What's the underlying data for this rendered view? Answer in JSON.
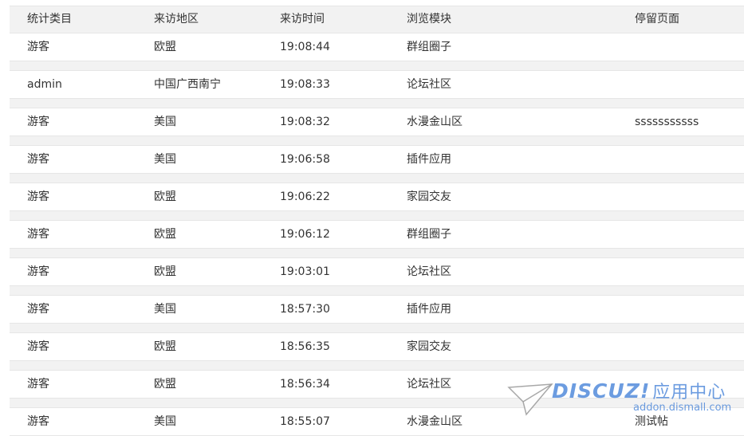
{
  "columns": [
    "统计类目",
    "来访地区",
    "来访时间",
    "浏览模块",
    "停留页面"
  ],
  "rows": [
    {
      "category": "游客",
      "region": "欧盟",
      "time": "19:08:44",
      "module": "群组圈子",
      "page": ""
    },
    {
      "category": "admin",
      "region": "中国广西南宁",
      "time": "19:08:33",
      "module": "论坛社区",
      "page": ""
    },
    {
      "category": "游客",
      "region": "美国",
      "time": "19:08:32",
      "module": "水漫金山区",
      "page": "sssssssssss"
    },
    {
      "category": "游客",
      "region": "美国",
      "time": "19:06:58",
      "module": "插件应用",
      "page": ""
    },
    {
      "category": "游客",
      "region": "欧盟",
      "time": "19:06:22",
      "module": "家园交友",
      "page": ""
    },
    {
      "category": "游客",
      "region": "欧盟",
      "time": "19:06:12",
      "module": "群组圈子",
      "page": ""
    },
    {
      "category": "游客",
      "region": "欧盟",
      "time": "19:03:01",
      "module": "论坛社区",
      "page": ""
    },
    {
      "category": "游客",
      "region": "美国",
      "time": "18:57:30",
      "module": "插件应用",
      "page": ""
    },
    {
      "category": "游客",
      "region": "欧盟",
      "time": "18:56:35",
      "module": "家园交友",
      "page": ""
    },
    {
      "category": "游客",
      "region": "欧盟",
      "time": "18:56:34",
      "module": "论坛社区",
      "page": ""
    },
    {
      "category": "游客",
      "region": "美国",
      "time": "18:55:07",
      "module": "水漫金山区",
      "page": "测试帖"
    }
  ],
  "watermark": {
    "brand": "DISCUZ!",
    "brand_cn": "应用中心",
    "url": "addon.dismall.com",
    "icon": "paper-plane-icon",
    "color": "#3b7cd6"
  }
}
